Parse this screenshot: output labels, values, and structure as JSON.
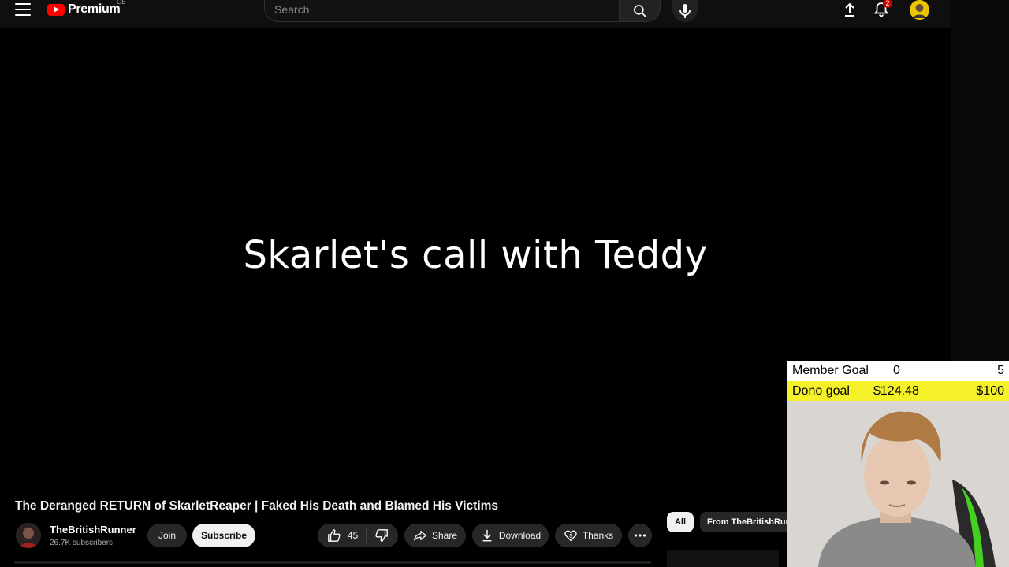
{
  "header": {
    "brand": "Premium",
    "region": "GB",
    "search_placeholder": "Search",
    "notifications_count": "2"
  },
  "video": {
    "overlay_text": "Skarlet's call with Teddy"
  },
  "meta": {
    "title": "The Deranged RETURN of SkarletReaper | Faked His Death and Blamed His Victims",
    "channel_name": "TheBritishRunner",
    "subscribers": "26.7K subscribers",
    "join_label": "Join",
    "subscribe_label": "Subscribe",
    "like_count": "45",
    "share_label": "Share",
    "download_label": "Download",
    "thanks_label": "Thanks"
  },
  "sidebar_chips": {
    "all": "All",
    "from_channel": "From TheBritishRunner"
  },
  "stream_overlay": {
    "member_goal_label": "Member Goal",
    "member_current": "0",
    "member_target": "5",
    "dono_goal_label": "Dono goal",
    "dono_current": "$124.48",
    "dono_target": "$100"
  },
  "colors": {
    "brand_red": "#ff0000",
    "dono_bar": "#f4f12a",
    "background": "#0f0f0f"
  }
}
